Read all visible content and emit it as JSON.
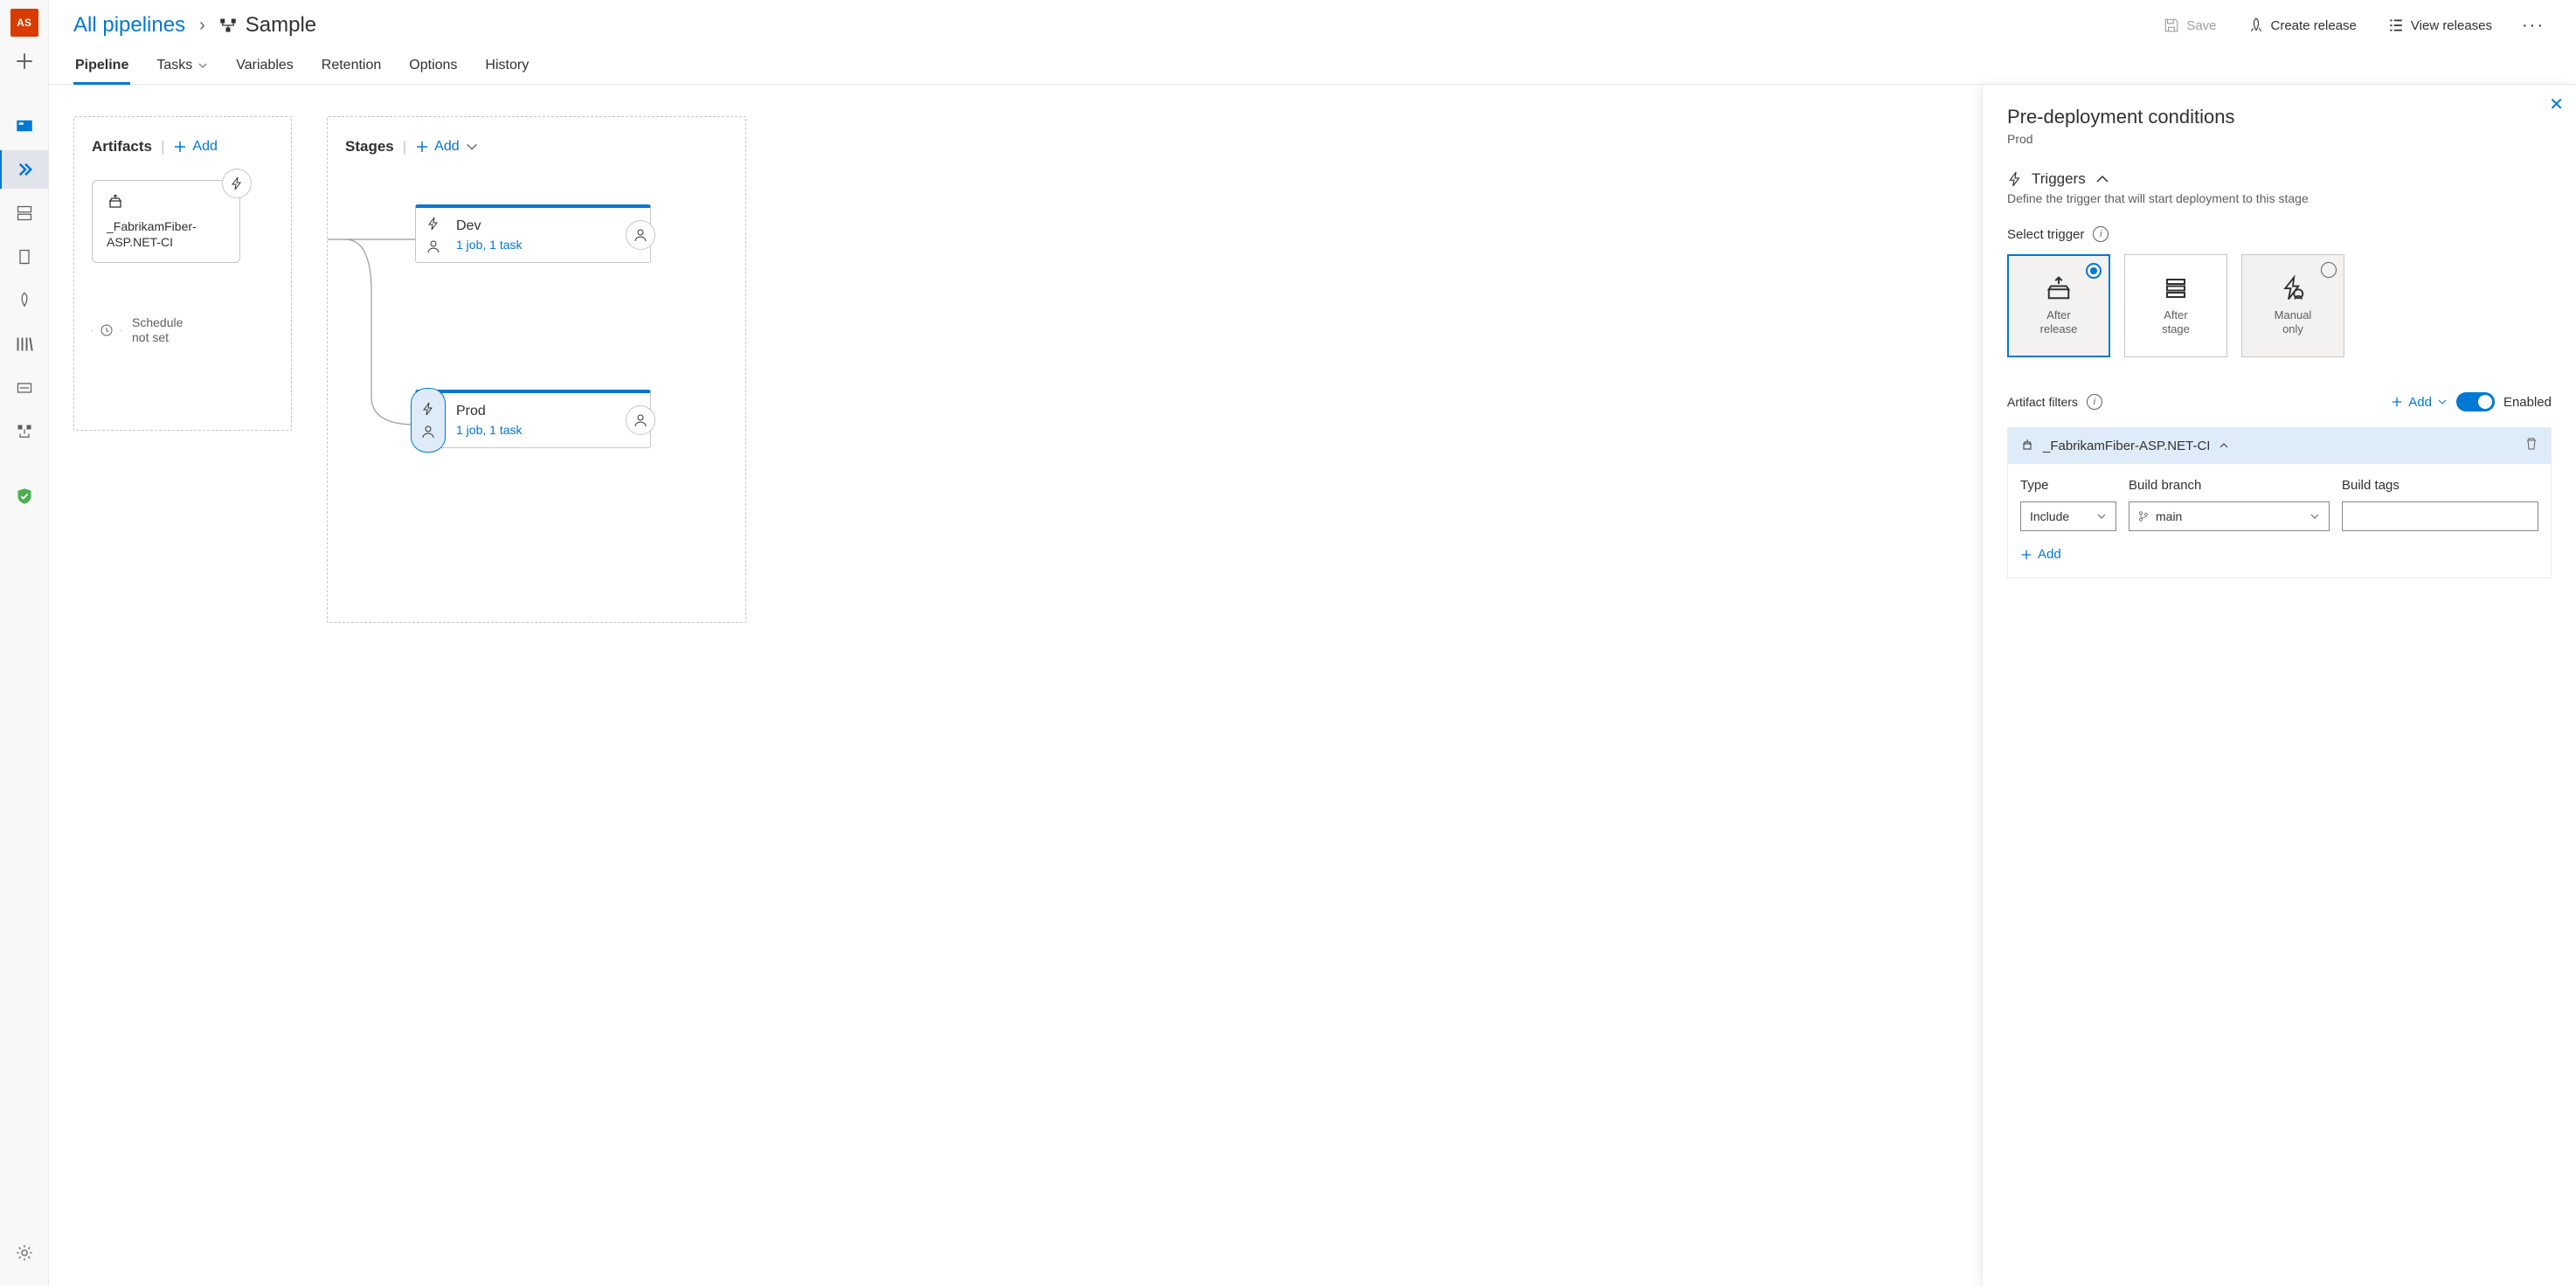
{
  "vnav": {
    "avatar": "AS"
  },
  "breadcrumb": {
    "root": "All pipelines",
    "name": "Sample"
  },
  "toolbar": {
    "save": "Save",
    "create_release": "Create release",
    "view_releases": "View releases"
  },
  "tabs": {
    "pipeline": "Pipeline",
    "tasks": "Tasks",
    "variables": "Variables",
    "retention": "Retention",
    "options": "Options",
    "history": "History"
  },
  "artifacts": {
    "heading": "Artifacts",
    "add": "Add",
    "source_name": "_FabrikamFiber-ASP.NET-CI",
    "schedule": "Schedule\nnot set"
  },
  "stages": {
    "heading": "Stages",
    "add": "Add",
    "dev": {
      "name": "Dev",
      "sub": "1 job, 1 task"
    },
    "prod": {
      "name": "Prod",
      "sub": "1 job, 1 task"
    }
  },
  "side": {
    "title": "Pre-deployment conditions",
    "stage": "Prod",
    "triggers_heading": "Triggers",
    "triggers_desc": "Define the trigger that will start deployment to this stage",
    "select_trigger": "Select trigger",
    "trigger_opts": {
      "after_release": "After\nrelease",
      "after_stage": "After\nstage",
      "manual_only": "Manual\nonly"
    },
    "artifact_filters": "Artifact filters",
    "add": "Add",
    "enabled": "Enabled",
    "filter_source": "_FabrikamFiber-ASP.NET-CI",
    "col_type": "Type",
    "col_branch": "Build branch",
    "col_tags": "Build tags",
    "type_value": "Include",
    "branch_value": "main",
    "add_row": "Add"
  }
}
